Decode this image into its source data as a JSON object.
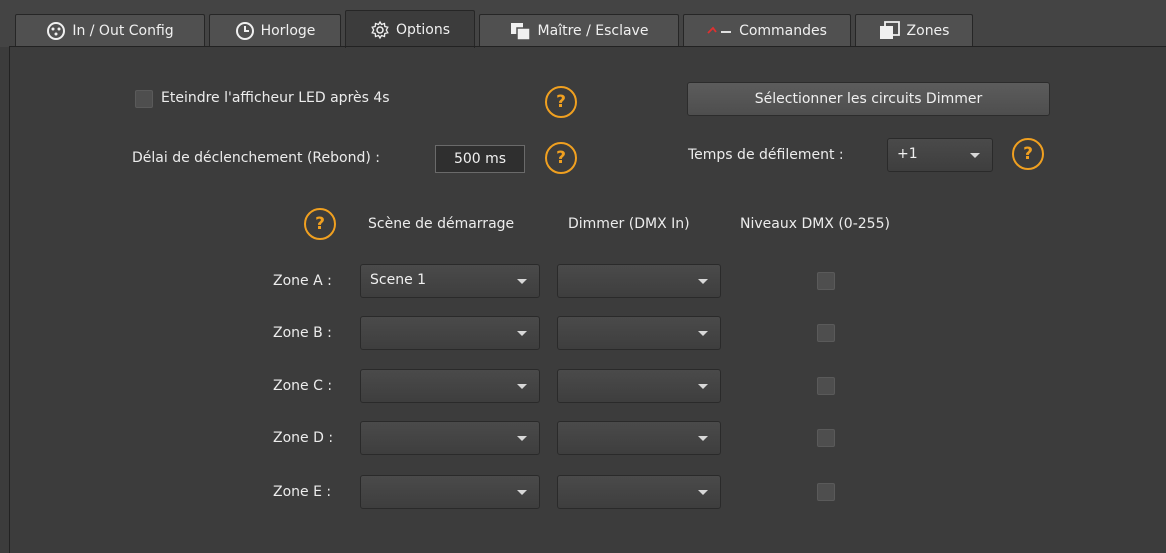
{
  "tabs": [
    {
      "label": "In / Out Config",
      "icon": "dmx-connector-icon"
    },
    {
      "label": "Horloge",
      "icon": "clock-icon"
    },
    {
      "label": "Options",
      "icon": "gear-icon"
    },
    {
      "label": "Maître / Esclave",
      "icon": "master-slave-icon"
    },
    {
      "label": "Commandes",
      "icon": "commands-icon"
    },
    {
      "label": "Zones",
      "icon": "zones-icon"
    }
  ],
  "active_tab": "Options",
  "options": {
    "led_off_label": "Eteindre l'afficheur LED après 4s",
    "led_off_checked": false,
    "dimmer_button": "Sélectionner les circuits Dimmer",
    "delay_label": "Délai de déclenchement (Rebond) :",
    "delay_value": "500 ms",
    "scroll_label": "Temps de défilement :",
    "scroll_value": "+1",
    "help_glyph": "?"
  },
  "zones_table": {
    "headers": [
      "Scène de démarrage",
      "Dimmer (DMX In)",
      "Niveaux DMX (0-255)"
    ],
    "rows": [
      {
        "label": "Zone A :",
        "scene": "Scene 1",
        "dimmer": "",
        "dmx_levels": false
      },
      {
        "label": "Zone B :",
        "scene": "",
        "dimmer": "",
        "dmx_levels": false
      },
      {
        "label": "Zone C :",
        "scene": "",
        "dimmer": "",
        "dmx_levels": false
      },
      {
        "label": "Zone D :",
        "scene": "",
        "dimmer": "",
        "dmx_levels": false
      },
      {
        "label": "Zone E :",
        "scene": "",
        "dimmer": "",
        "dmx_levels": false
      }
    ]
  },
  "colors": {
    "background": "#3c3c3c",
    "help_accent": "#f0a020",
    "commands_red": "#e03030"
  }
}
